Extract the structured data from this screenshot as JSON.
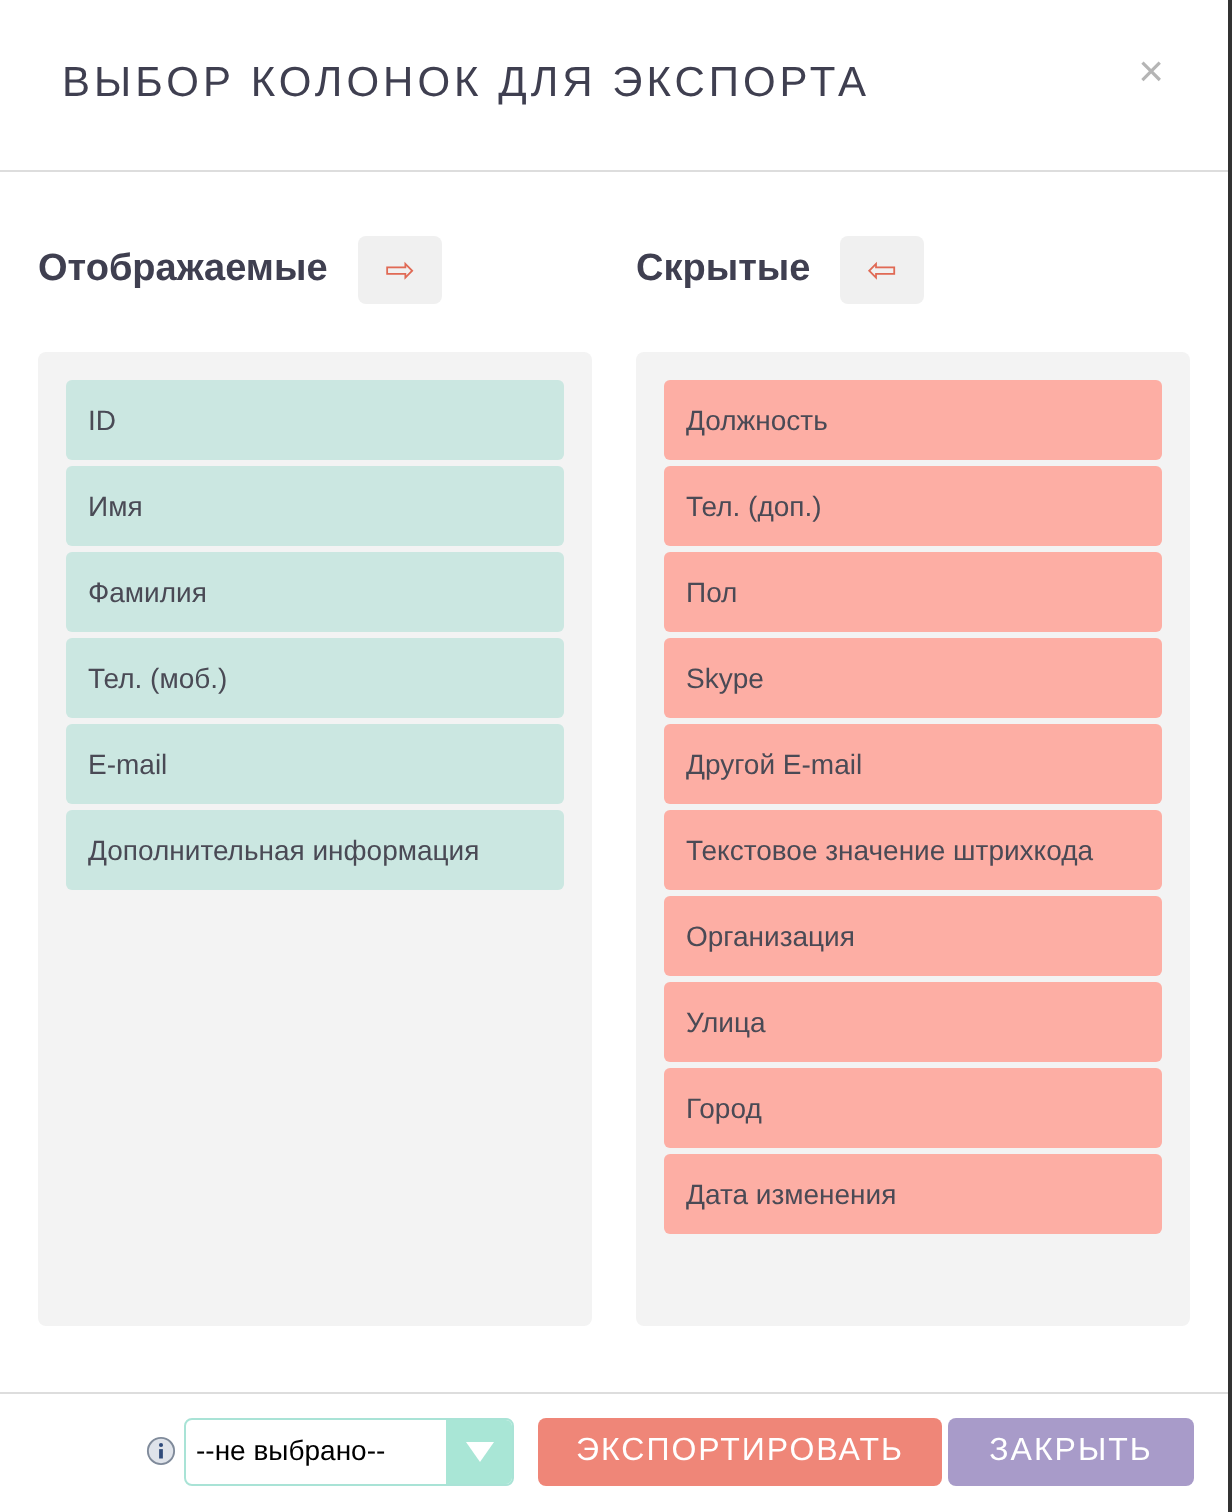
{
  "dialog": {
    "title": "ВЫБОР КОЛОНОК ДЛЯ ЭКСПОРТА",
    "close": "×"
  },
  "columns": [
    {
      "kind": "shown",
      "heading": "Отображаемые",
      "arrow": "⇨",
      "items": [
        "ID",
        "Имя",
        "Фамилия",
        "Тел. (моб.)",
        "E-mail",
        "Дополнительная информация"
      ]
    },
    {
      "kind": "hidden",
      "heading": "Скрытые",
      "arrow": "⇦",
      "items": [
        "Должность",
        "Тел. (доп.)",
        "Пол",
        "Skype",
        "Другой E-mail",
        "Текстовое значение штрихкода",
        "Организация",
        "Улица",
        "Город",
        "Дата изменения"
      ]
    }
  ],
  "footer": {
    "select": {
      "value": "--не выбрано--"
    },
    "export_button": "ЭКСПОРТИРОВАТЬ",
    "close_button": "ЗАКРЫТЬ"
  }
}
